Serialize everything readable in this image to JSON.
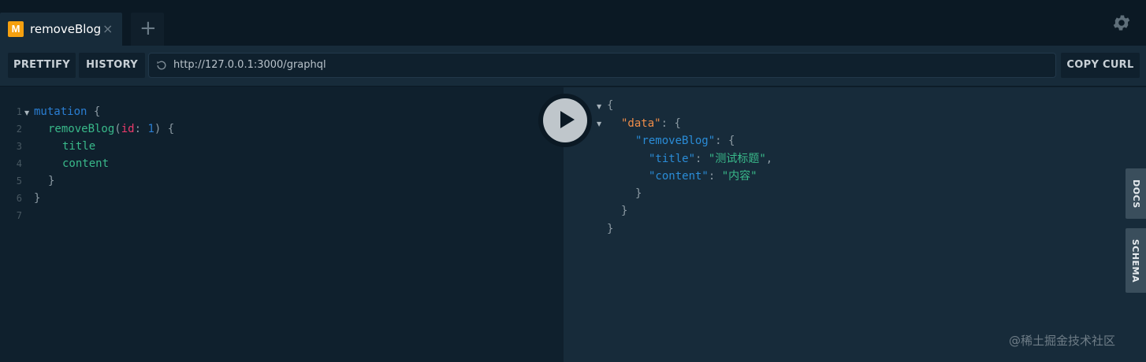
{
  "tabs": {
    "active": {
      "badge": "M",
      "title": "removeBlog",
      "close": "×"
    },
    "add_label": "+"
  },
  "toolbar": {
    "prettify_label": "PRETTIFY",
    "history_label": "HISTORY",
    "url": "http://127.0.0.1:3000/graphql",
    "copy_curl_label": "COPY CURL"
  },
  "editor": {
    "line_numbers": [
      "1",
      "2",
      "3",
      "4",
      "5",
      "6",
      "7"
    ],
    "lines": {
      "l1_keyword": "mutation",
      "l1_brace": "{",
      "l2_field": "removeBlog",
      "l2_open": "(",
      "l2_arg": "id",
      "l2_colon": ":",
      "l2_value": "1",
      "l2_close": ")",
      "l2_brace": "{",
      "l3_field": "title",
      "l4_field": "content",
      "l5_brace": "}",
      "l6_brace": "}"
    }
  },
  "result": {
    "open_brace": "{",
    "data_key": "\"data\"",
    "colon": ":",
    "data_brace": "{",
    "remove_key": "\"removeBlog\"",
    "remove_brace": "{",
    "title_key": "\"title\"",
    "title_value": "\"测试标题\"",
    "comma": ",",
    "content_key": "\"content\"",
    "content_value": "\"内容\"",
    "close_remove": "}",
    "close_data": "}",
    "close_root": "}"
  },
  "side_tabs": {
    "docs": "DOCS",
    "schema": "SCHEMA"
  },
  "icons": {
    "gear": "gear-icon",
    "reload": "reload-icon",
    "play": "play-icon",
    "fold": "fold-arrow-icon"
  },
  "colors": {
    "badge": "#f5a00f",
    "keyword": "#2a7ed3",
    "field": "#39b98a",
    "argument": "#ed3a6b",
    "json_data_key": "#f08d49",
    "json_key": "#2a8cd7",
    "json_string": "#39b98a"
  },
  "watermark": "@稀土掘金技术社区"
}
